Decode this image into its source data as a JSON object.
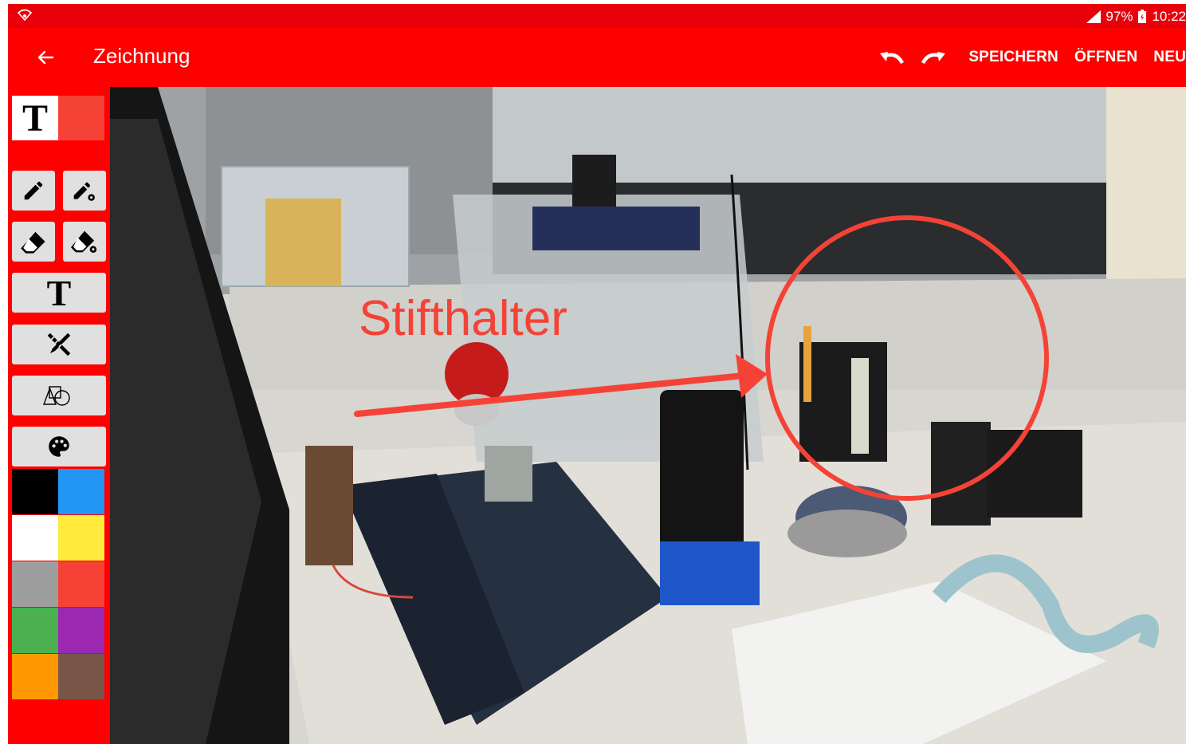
{
  "status_bar": {
    "signal_icon": "signal-icon",
    "battery_percent": "97%",
    "time": "10:22"
  },
  "app_bar": {
    "title": "Zeichnung",
    "save_label": "SPEICHERN",
    "open_label": "ÖFFNEN",
    "new_label": "NEU",
    "icons": [
      "back-arrow-icon",
      "undo-icon",
      "redo-icon"
    ]
  },
  "toolbar": {
    "current_tool_glyph": "T",
    "text_tool_glyph": "T",
    "tools": [
      "pencil",
      "pencil-settings",
      "eraser",
      "eraser-settings",
      "text",
      "ruler-pencil",
      "shapes",
      "palette"
    ]
  },
  "palette": {
    "colors": [
      "#000000",
      "#2196f3",
      "#ffffff",
      "#ffeb3b",
      "#9e9e9e",
      "#f44336",
      "#4caf50",
      "#9c27b0",
      "#ff9800",
      "#795548"
    ],
    "current_color": "#f44336"
  },
  "canvas": {
    "annotation_text": "Stifthalter",
    "annotation_color": "#f44336"
  },
  "colors": {
    "accent": "#ff0000",
    "status_bar": "#e8000b"
  }
}
